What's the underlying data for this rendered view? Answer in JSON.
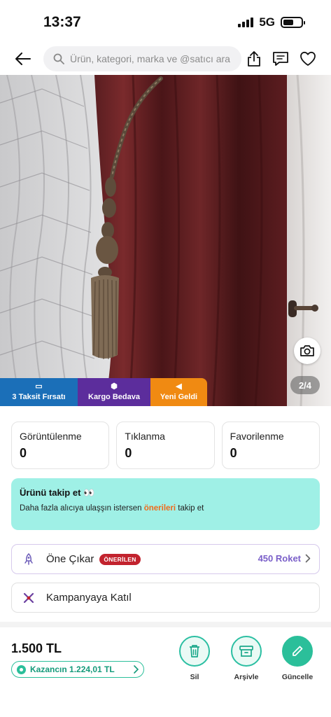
{
  "status_bar": {
    "time": "13:37",
    "network": "5G"
  },
  "search": {
    "placeholder": "Ürün, kategori, marka ve @satıcı ara"
  },
  "gallery": {
    "counter": "2/4"
  },
  "badges": [
    {
      "label": "3 Taksit Fırsatı",
      "color": "#1b6fb8"
    },
    {
      "label": "Kargo Bedava",
      "color": "#5c2d9c"
    },
    {
      "label": "Yeni Geldi",
      "color": "#f08a12"
    }
  ],
  "stats": [
    {
      "label": "Görüntülenme",
      "value": "0"
    },
    {
      "label": "Tıklanma",
      "value": "0"
    },
    {
      "label": "Favorilenme",
      "value": "0"
    }
  ],
  "follow": {
    "title": "Ürünü takip et 👀",
    "desc_before": "Daha fazla alıcıya ulaşşın istersen ",
    "desc_link": "önerileri",
    "desc_after": " takip et"
  },
  "promote": {
    "label": "Öne Çıkar",
    "badge": "ÖNERİLEN",
    "roket": "450 Roket"
  },
  "campaign": {
    "label": "Kampanyaya Katıl"
  },
  "footer": {
    "price": "1.500 TL",
    "earnings": "Kazancın 1.224,01 TL",
    "actions": [
      "Sil",
      "Arşivle",
      "Güncelle"
    ]
  },
  "colors": {
    "accent_teal": "#2bbf9a",
    "follow_bg": "#9ff0e6",
    "recommended_red": "#c2232e",
    "roket_purple": "#7a5fc9"
  }
}
